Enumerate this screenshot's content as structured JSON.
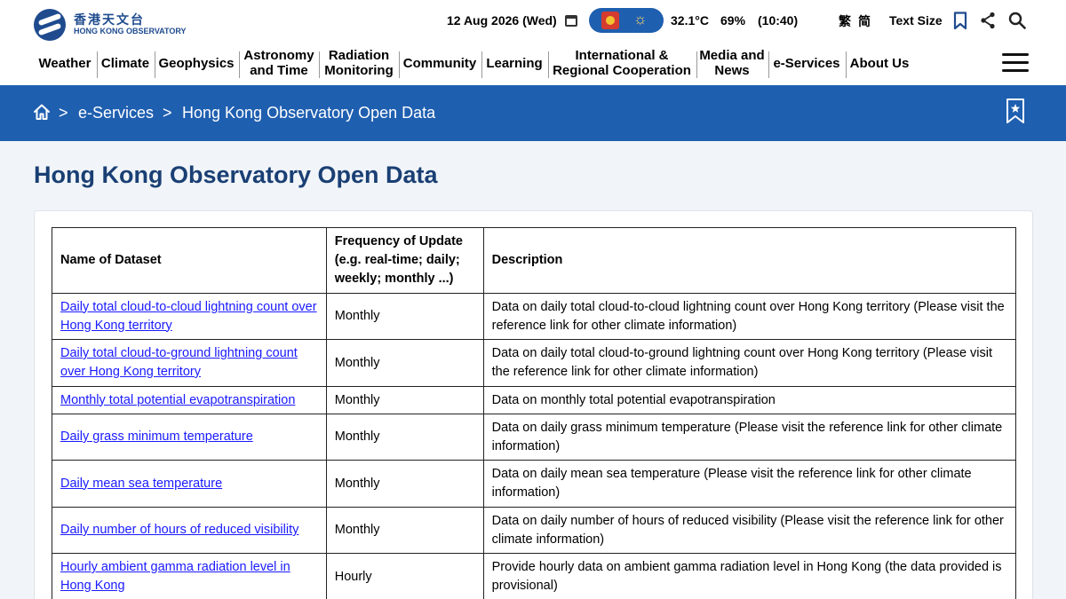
{
  "header": {
    "logo_zh": "香港天文台",
    "logo_en": "HONG KONG OBSERVATORY",
    "date": "12 Aug 2026 (Wed)",
    "temperature": "32.1°C",
    "humidity": "69%",
    "time": "(10:40)",
    "lang_traditional": "繁",
    "lang_simplified": "简",
    "text_size": "Text Size",
    "icons": [
      "calendar-icon",
      "weather-warning-icon",
      "sunny-icon",
      "bookmark-icon",
      "share-icon",
      "search-icon"
    ]
  },
  "nav": {
    "items": [
      {
        "label": "Weather"
      },
      {
        "label": "Climate"
      },
      {
        "label": "Geophysics"
      },
      {
        "label": "Astronomy and Time"
      },
      {
        "label": "Radiation Monitoring"
      },
      {
        "label": "Community"
      },
      {
        "label": "Learning"
      },
      {
        "label": "International & Regional Cooperation"
      },
      {
        "label": "Media and News"
      },
      {
        "label": "e-Services"
      },
      {
        "label": "About Us"
      }
    ]
  },
  "breadcrumb": {
    "separator": ">",
    "items": [
      "e-Services",
      "Hong Kong Observatory Open Data"
    ]
  },
  "page": {
    "title": "Hong Kong Observatory Open Data"
  },
  "table": {
    "headers": [
      "Name of Dataset",
      "Frequency of Update (e.g. real-time; daily; weekly; monthly ...)",
      "Description"
    ],
    "rows": [
      {
        "name": "Daily total cloud-to-cloud lightning count over Hong Kong territory",
        "freq": "Monthly",
        "desc": "Data on daily total cloud-to-cloud lightning count over Hong Kong territory (Please visit the reference link for other climate information)"
      },
      {
        "name": "Daily total cloud-to-ground lightning count over Hong Kong territory",
        "freq": "Monthly",
        "desc": "Data on daily total cloud-to-ground lightning count over Hong Kong territory (Please visit the reference link for other climate information)"
      },
      {
        "name": "Monthly total potential evapotranspiration",
        "freq": "Monthly",
        "desc": "Data on monthly total potential evapotranspiration"
      },
      {
        "name": "Daily grass minimum temperature",
        "freq": "Monthly",
        "desc": "Data on daily grass minimum temperature (Please visit the reference link for other climate information)"
      },
      {
        "name": "Daily mean sea temperature",
        "freq": "Monthly",
        "desc": "Data on daily mean sea temperature (Please visit the reference link for other climate information)"
      },
      {
        "name": "Daily number of hours of reduced visibility",
        "freq": "Monthly",
        "desc": "Data on daily number of hours of reduced visibility (Please visit the reference link for other climate information)"
      },
      {
        "name": "Hourly ambient gamma radiation level in Hong Kong",
        "freq": "Hourly",
        "desc": "Provide hourly data on ambient gamma radiation level in Hong Kong (the data provided is provisional)"
      }
    ]
  }
}
